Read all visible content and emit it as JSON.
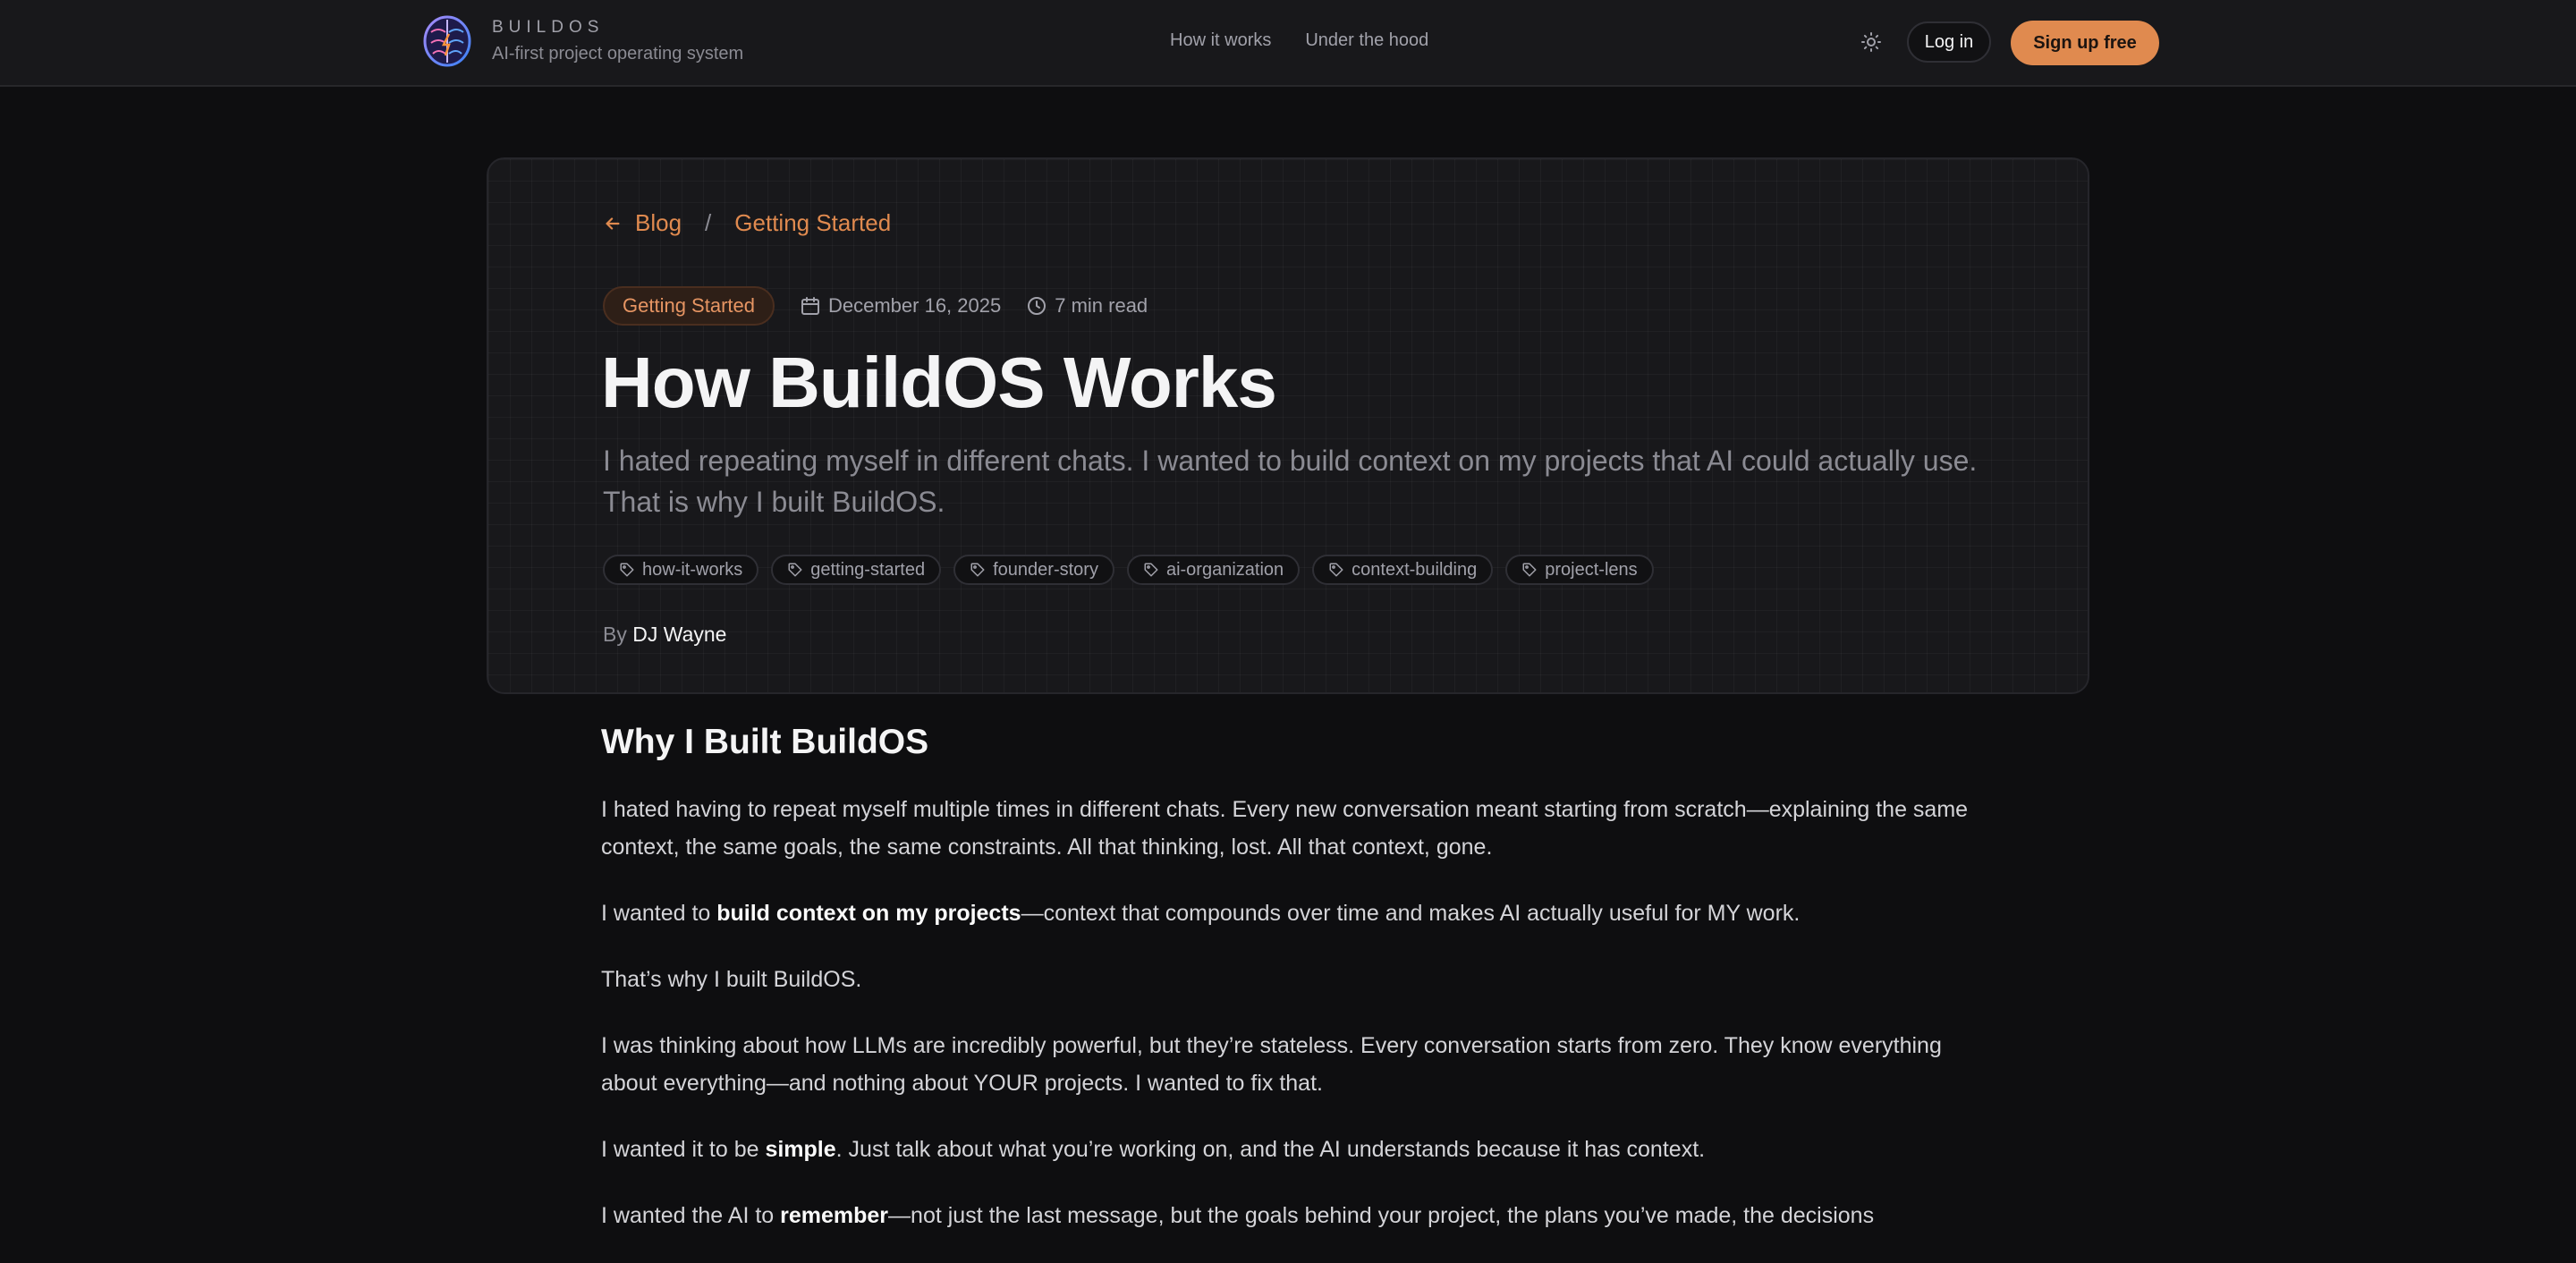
{
  "header": {
    "brand_name": "BUILDOS",
    "brand_tagline": "AI-first project operating system",
    "nav": [
      {
        "label": "How it works"
      },
      {
        "label": "Under the hood"
      }
    ],
    "login_label": "Log in",
    "signup_label": "Sign up free"
  },
  "hero": {
    "breadcrumb": {
      "back_label": "Blog",
      "separator": "/",
      "current": "Getting Started"
    },
    "category": "Getting Started",
    "date": "December 16, 2025",
    "read_time": "7 min read",
    "title": "How BuildOS Works",
    "subtitle": "I hated repeating myself in different chats. I wanted to build context on my projects that AI could actually use. That is why I built BuildOS.",
    "tags": [
      "how-it-works",
      "getting-started",
      "founder-story",
      "ai-organization",
      "context-building",
      "project-lens"
    ],
    "byline_prefix": "By",
    "author": "DJ Wayne"
  },
  "article": {
    "heading": "Why I Built BuildOS",
    "p1": "I hated having to repeat myself multiple times in different chats. Every new conversation meant starting from scratch—explaining the same context, the same goals, the same constraints. All that thinking, lost. All that context, gone.",
    "p2_pre": "I wanted to ",
    "p2_bold": "build context on my projects",
    "p2_post": "—context that compounds over time and makes AI actually useful for MY work.",
    "p3": "That’s why I built BuildOS.",
    "p4": "I was thinking about how LLMs are incredibly powerful, but they’re stateless. Every conversation starts from zero. They know everything about everything—and nothing about YOUR projects. I wanted to fix that.",
    "p5_pre": "I wanted it to be ",
    "p5_bold": "simple",
    "p5_post": ". Just talk about what you’re working on, and the AI understands because it has context.",
    "p6_pre": "I wanted the AI to ",
    "p6_bold": "remember",
    "p6_post": "—not just the last message, but the goals behind your project, the plans you’ve made, the decisions"
  },
  "colors": {
    "accent": "#e08a4f",
    "background": "#0e0e10",
    "surface": "#18181b"
  },
  "icons": [
    "brain-logo-icon",
    "sun-icon",
    "arrow-left-icon",
    "calendar-icon",
    "clock-icon",
    "tag-icon"
  ]
}
